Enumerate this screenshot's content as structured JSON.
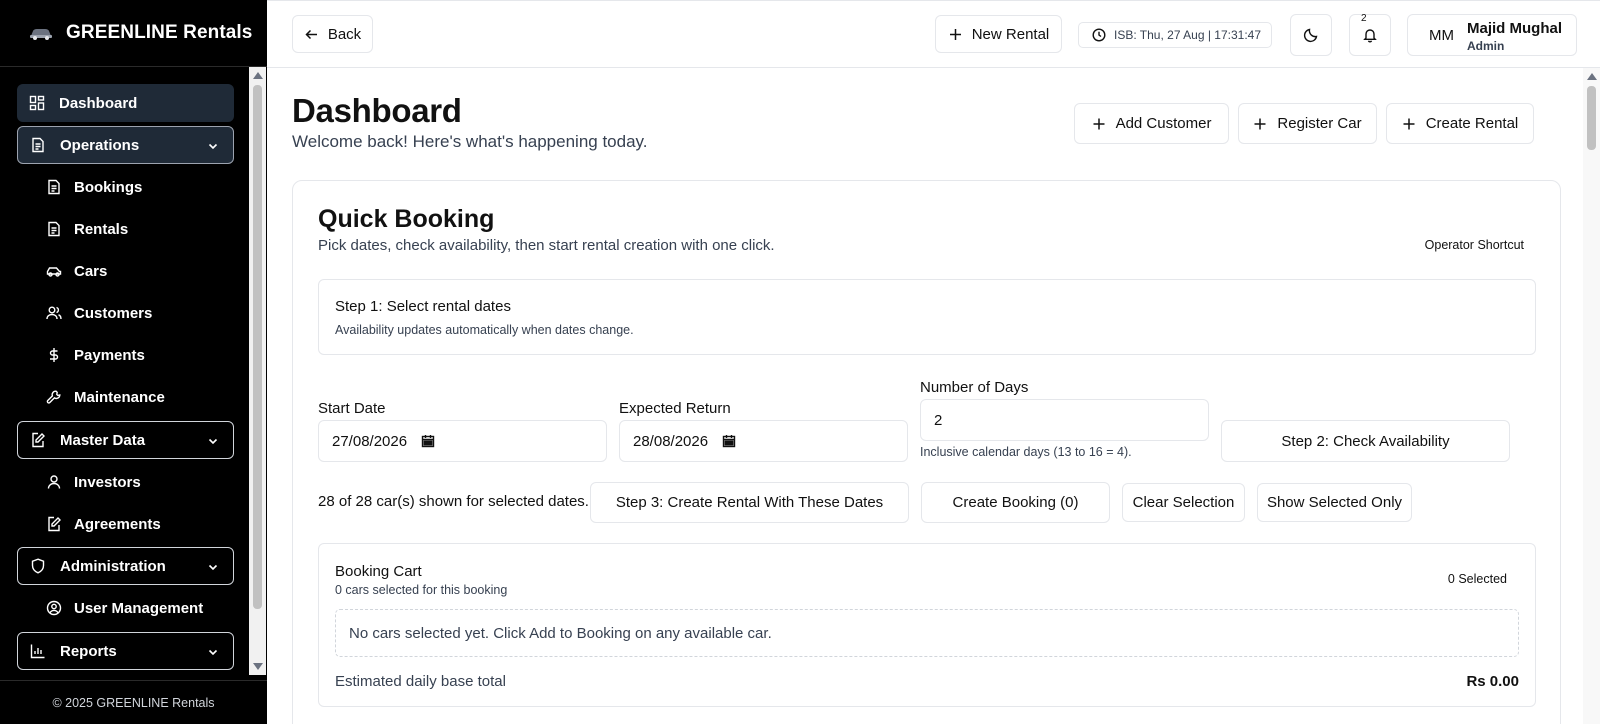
{
  "brand": {
    "name": "GREENLINE Rentals",
    "logo_icon": "car-logo-icon"
  },
  "sidebar": {
    "dashboard": "Dashboard",
    "operations": "Operations",
    "operations_items": [
      "Bookings",
      "Rentals",
      "Cars",
      "Customers",
      "Payments",
      "Maintenance"
    ],
    "master_data": "Master Data",
    "master_items": [
      "Investors",
      "Agreements"
    ],
    "administration": "Administration",
    "admin_items": [
      "User Management"
    ],
    "reports": "Reports",
    "copyright": "© 2025 GREENLINE Rentals"
  },
  "topbar": {
    "back": "Back",
    "new_rental": "New Rental",
    "clock": "ISB: Thu, 27 Aug | 17:31:47",
    "notifications_count": "2",
    "user_initials": "MM",
    "user_name": "Majid Mughal",
    "user_role": "Admin"
  },
  "page": {
    "title": "Dashboard",
    "subtitle": "Welcome back! Here's what's happening today.",
    "add_customer": "Add Customer",
    "register_car": "Register Car",
    "create_rental": "Create Rental"
  },
  "quick_booking": {
    "title": "Quick Booking",
    "subtitle": "Pick dates, check availability, then start rental creation with one click.",
    "operator_shortcut": "Operator Shortcut",
    "step1_title": "Step 1: Select rental dates",
    "step1_sub": "Availability updates automatically when dates change.",
    "start_date_label": "Start Date",
    "start_date_value": "27/08/2026",
    "return_label": "Expected Return",
    "return_value": "28/08/2026",
    "days_label": "Number of Days",
    "days_value": "2",
    "days_hint": "Inclusive calendar days (13 to 16 = 4).",
    "step2": "Step 2: Check Availability",
    "shown_text": "28 of 28 car(s) shown for selected dates.",
    "step3": "Step 3: Create Rental With These Dates",
    "create_booking": "Create Booking (0)",
    "clear_selection": "Clear Selection",
    "show_selected": "Show Selected Only"
  },
  "cart": {
    "title": "Booking Cart",
    "subtitle": "0 cars selected for this booking",
    "selected_count": "0 Selected",
    "empty": "No cars selected yet. Click Add to Booking on any available car.",
    "estimate_label": "Estimated daily base total",
    "estimate_value": "Rs 0.00"
  }
}
